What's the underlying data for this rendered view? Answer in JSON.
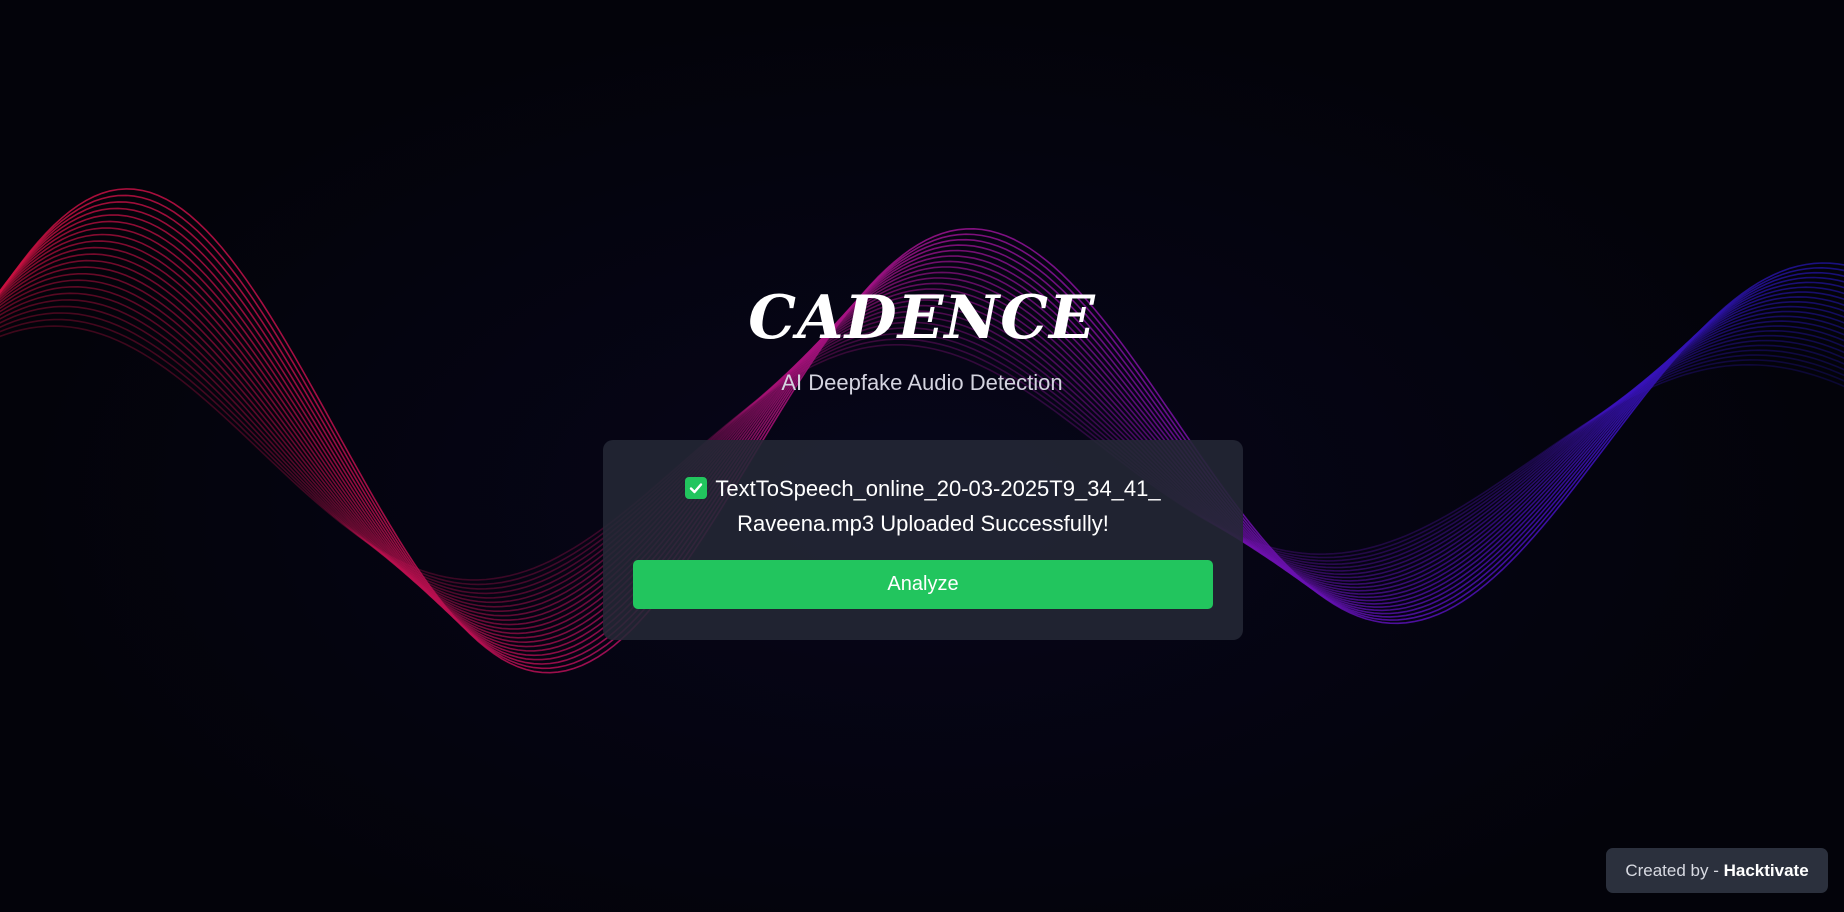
{
  "brand": {
    "title": "CADENCE",
    "tagline": "AI Deepfake Audio Detection"
  },
  "upload": {
    "status_line1": "TextToSpeech_online_20-03-2025T9_34_41_",
    "status_line2": "Raveena.mp3 Uploaded Successfully!",
    "status_icon": "check-square-icon",
    "analyze_label": "Analyze"
  },
  "footer": {
    "created_by_prefix": "Created by - ",
    "created_by_name": "Hacktivate"
  },
  "colors": {
    "background": "#04040c",
    "accent_green": "#22c55e",
    "card": "#242836",
    "wave_left": "#e0154d",
    "wave_center": "#b0139a",
    "wave_right": "#3b0fd0"
  }
}
